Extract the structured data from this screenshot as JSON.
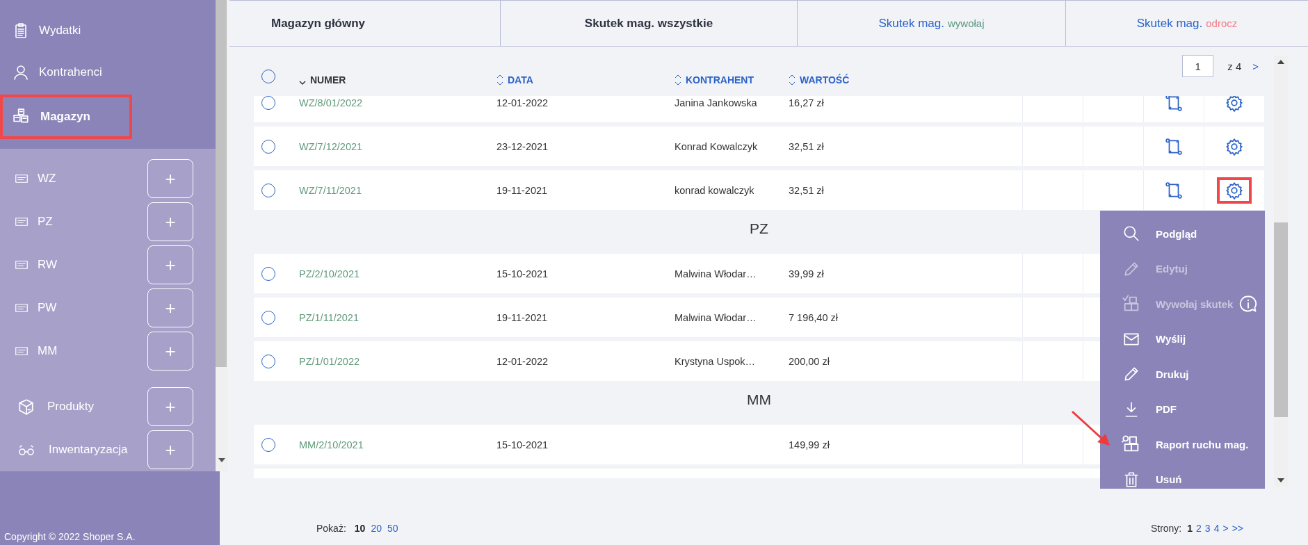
{
  "sidebar": {
    "nav": [
      {
        "label": "Wydatki",
        "kind": "expenses",
        "selected": false,
        "highlighted": false
      },
      {
        "label": "Kontrahenci",
        "kind": "contacts",
        "selected": false,
        "highlighted": false
      },
      {
        "label": "Magazyn",
        "kind": "warehouse",
        "selected": true,
        "highlighted": true
      }
    ],
    "documents": [
      {
        "label": "WZ",
        "button": "+"
      },
      {
        "label": "PZ",
        "button": "+"
      },
      {
        "label": "RW",
        "button": "+"
      },
      {
        "label": "PW",
        "button": "+"
      },
      {
        "label": "MM",
        "button": "+"
      }
    ],
    "catalog": [
      {
        "label": "Produkty",
        "kind": "products",
        "button": "+"
      },
      {
        "label": "Inwentaryzacja",
        "kind": "inventory",
        "button": "+"
      }
    ],
    "copyright": "Copyright © 2022 Shoper S.A."
  },
  "warehouse": {
    "label": "Magazyn główny"
  },
  "tabs": [
    {
      "label": "Skutek mag. wszystkie",
      "selected": true
    },
    {
      "label": "Skutek mag.",
      "suffix": "wywołaj",
      "color": "#5a9a80",
      "selected": false
    },
    {
      "label": "Skutek mag.",
      "suffix": "odrocz",
      "color": "#f07a86",
      "selected": false
    }
  ],
  "table": {
    "select_all": {
      "checked": false
    },
    "columns": [
      {
        "label": "NUMER",
        "sorted": true
      },
      {
        "label": "DATA",
        "sorted": false
      },
      {
        "label": "KONTRAHENT",
        "sorted": false
      },
      {
        "label": "WARTOŚĆ",
        "sorted": false
      }
    ],
    "pager": {
      "page": "1",
      "of": "z 4",
      "next": ">"
    },
    "groups": [
      {
        "rows": [
          {
            "numer": "WZ/8/01/2022",
            "data": "12-01-2022",
            "kontrahent": "Janina Jankowska",
            "wartosc": "16,27 zł",
            "checked": false,
            "actions": true,
            "menu_open": false
          },
          {
            "numer": "WZ/7/12/2021",
            "data": "23-12-2021",
            "kontrahent": "Konrad Kowalczyk",
            "wartosc": "32,51 zł",
            "checked": false,
            "actions": true,
            "menu_open": false
          },
          {
            "numer": "WZ/7/11/2021",
            "data": "19-11-2021",
            "kontrahent": "konrad kowalczyk",
            "wartosc": "32,51 zł",
            "checked": false,
            "actions": true,
            "menu_open": true
          }
        ]
      },
      {
        "title": "PZ",
        "rows": [
          {
            "numer": "PZ/2/10/2021",
            "data": "15-10-2021",
            "kontrahent": "Malwina Włodar…",
            "wartosc": "39,99 zł",
            "checked": false
          },
          {
            "numer": "PZ/1/11/2021",
            "data": "19-11-2021",
            "kontrahent": "Malwina Włodar…",
            "wartosc": "7 196,40 zł",
            "checked": false
          },
          {
            "numer": "PZ/1/01/2022",
            "data": "12-01-2022",
            "kontrahent": "Krystyna Uspok…",
            "wartosc": "200,00 zł",
            "checked": false
          }
        ]
      },
      {
        "title": "MM",
        "rows": [
          {
            "numer": "MM/2/10/2021",
            "data": "15-10-2021",
            "wartosc": "149,99 zł",
            "checked": false
          }
        ]
      }
    ]
  },
  "menu": [
    {
      "label": "Podgląd",
      "kind": "preview",
      "disabled": false
    },
    {
      "label": "Edytuj",
      "kind": "edit",
      "disabled": true
    },
    {
      "label": "Wywołaj skutek",
      "kind": "effect",
      "disabled": true,
      "info": true
    },
    {
      "label": "Wyślij",
      "kind": "send",
      "disabled": false
    },
    {
      "label": "Drukuj",
      "kind": "print",
      "disabled": false
    },
    {
      "label": "PDF",
      "kind": "pdf",
      "disabled": false
    },
    {
      "label": "Raport ruchu mag.",
      "kind": "report",
      "disabled": false,
      "pointed": true
    },
    {
      "label": "Usuń",
      "kind": "delete",
      "disabled": false
    }
  ],
  "footer": {
    "show_label": "Pokaż:",
    "sizes": [
      {
        "label": "10",
        "selected": true
      },
      {
        "label": "20",
        "selected": false
      },
      {
        "label": "50",
        "selected": false
      }
    ],
    "pages_label": "Strony:",
    "pages": [
      {
        "label": "1",
        "selected": true
      },
      {
        "label": "2",
        "selected": false
      },
      {
        "label": "3",
        "selected": false
      },
      {
        "label": "4",
        "selected": false
      }
    ],
    "next": ">",
    "last": ">>"
  }
}
